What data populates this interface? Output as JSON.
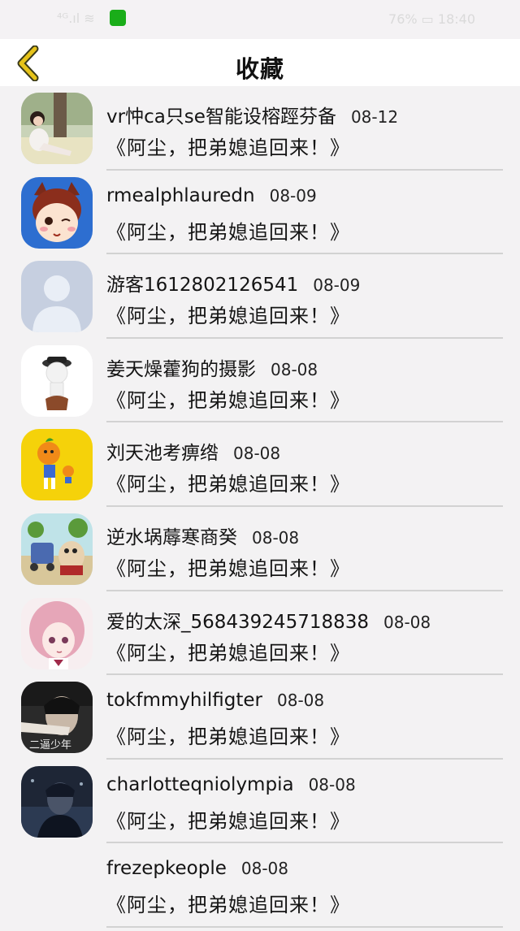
{
  "status_bar": {
    "left_text": "⁴ᴳ.ıl ≋",
    "right_text": "76% ▭ 18:40"
  },
  "header": {
    "title": "收藏",
    "back_icon": "chevron-left-icon",
    "accent_color": "#e6c31a"
  },
  "favorites": [
    {
      "name": "vr忡ca只se智能设榕踁芬备",
      "date": "08-12",
      "book": "《阿尘，把弟媳追回来！》",
      "avatar": "photo-girl"
    },
    {
      "name": "rmealphlauredn",
      "date": "08-09",
      "book": "《阿尘，把弟媳追回来！》",
      "avatar": "cartoon-cat"
    },
    {
      "name": "游客1612802126541",
      "date": "08-09",
      "book": "《阿尘，把弟媳追回来！》",
      "avatar": "default-user"
    },
    {
      "name": "姜天燥藿狗的摄影",
      "date": "08-08",
      "book": "《阿尘，把弟媳追回来！》",
      "avatar": "police-figure"
    },
    {
      "name": "刘天池考痹绺",
      "date": "08-08",
      "book": "《阿尘，把弟媳追回来！》",
      "avatar": "orange-mascot"
    },
    {
      "name": "逆水埚蓐寒商癸",
      "date": "08-08",
      "book": "《阿尘，把弟媳追回来！》",
      "avatar": "cartoon-stroller"
    },
    {
      "name": "爱的太深_568439245718838",
      "date": "08-08",
      "book": "《阿尘，把弟媳追回来！》",
      "avatar": "anime-girl"
    },
    {
      "name": "tokfmmyhilfigter",
      "date": "08-08",
      "book": "《阿尘，把弟媳追回来！》",
      "avatar": "dark-portrait"
    },
    {
      "name": "charlotteqniolympia",
      "date": "08-08",
      "book": "《阿尘，把弟媳追回来！》",
      "avatar": "night-portrait"
    },
    {
      "name": "frezepkeople",
      "date": "08-08",
      "book": "《阿尘，把弟媳追回来！》",
      "avatar": "none"
    }
  ]
}
